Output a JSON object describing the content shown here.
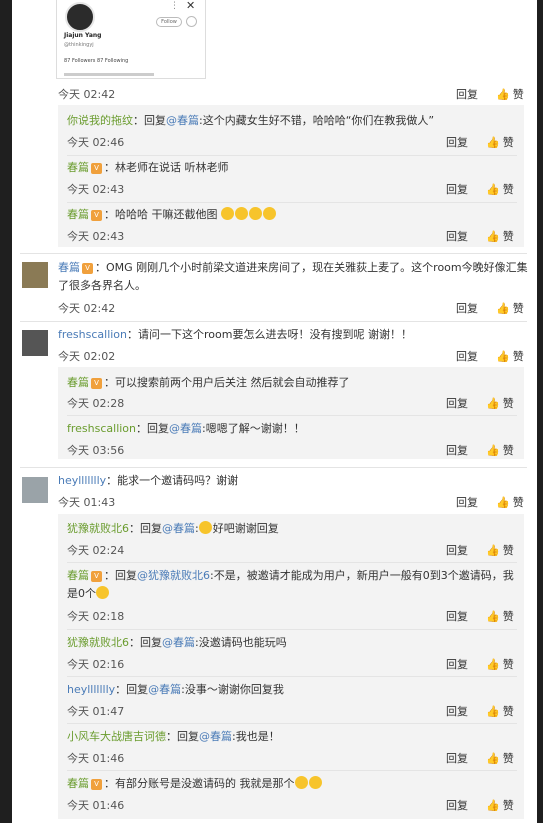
{
  "labels": {
    "reply": "回复",
    "like": "赞"
  },
  "thumb": {
    "name": "Jiajun Yang",
    "handle": "@thinkingyj",
    "follow": "Follow",
    "stats": "87 Followers   87 Following"
  },
  "c1": {
    "time": "今天 02:42"
  },
  "r1a": {
    "name": "你说我的拖纹",
    "pre": "：回复",
    "at": "@春篇",
    "text": ":这个内藏女生好不错，哈哈哈“你们在教我做人”",
    "time": "今天 02:46"
  },
  "r1b": {
    "name": "春篇",
    "text": "：林老师在说话 听林老师",
    "time": "今天 02:43"
  },
  "r1c": {
    "name": "春篇",
    "text": "：哈哈哈 干嘛还截他图",
    "time": "今天 02:43"
  },
  "c2": {
    "name": "春篇",
    "line1": "：OMG 刚刚几个小时前梁文道进来房间了，现在关雅荻上麦了。这个room今晚好像汇集",
    "line2": "了很多各界名人。",
    "time": "今天 02:42"
  },
  "c3": {
    "name": "freshscallion",
    "text": "：请问一下这个room要怎么进去呀！没有搜到呢 谢谢！！",
    "time": "今天 02:02"
  },
  "r3a": {
    "name": "春篇",
    "text": "：可以搜索前两个用户后关注 然后就会自动推荐了",
    "time": "今天 02:28"
  },
  "r3b": {
    "name": "freshscallion",
    "pre": "：回复",
    "at": "@春篇",
    "text": ":嗯嗯了解～谢谢！！",
    "time": "今天 03:56"
  },
  "c4": {
    "name": "heyllllllly",
    "text": "：能求一个邀请码吗？谢谢",
    "time": "今天 01:43"
  },
  "r4a": {
    "name": "犹豫就败北6",
    "pre": "：回复",
    "at": "@春篇",
    "text": "好吧谢谢回复",
    "time": "今天 02:24"
  },
  "r4b": {
    "name": "春篇",
    "pre": "：回复",
    "at": "@犹豫就败北6",
    "line1": ":不是，被邀请才能成为用户，新用户一般有0到3个邀请码，我",
    "line2": "是0个",
    "time": "今天 02:18"
  },
  "r4c": {
    "name": "犹豫就败北6",
    "pre": "：回复",
    "at": "@春篇",
    "text": ":没邀请码也能玩吗",
    "time": "今天 02:16"
  },
  "r4d": {
    "name": "heyllllllly",
    "pre": "：回复",
    "at": "@春篇",
    "text": ":没事～谢谢你回复我",
    "time": "今天 01:47"
  },
  "r4e": {
    "name": "小风车大战唐吉诃德",
    "pre": "：回复",
    "at": "@春篇",
    "text": ":我也是！",
    "time": "今天 01:46"
  },
  "r4f": {
    "name": "春篇",
    "text": "：有部分账号是没邀请码的 我就是那个",
    "time": "今天 01:46"
  }
}
